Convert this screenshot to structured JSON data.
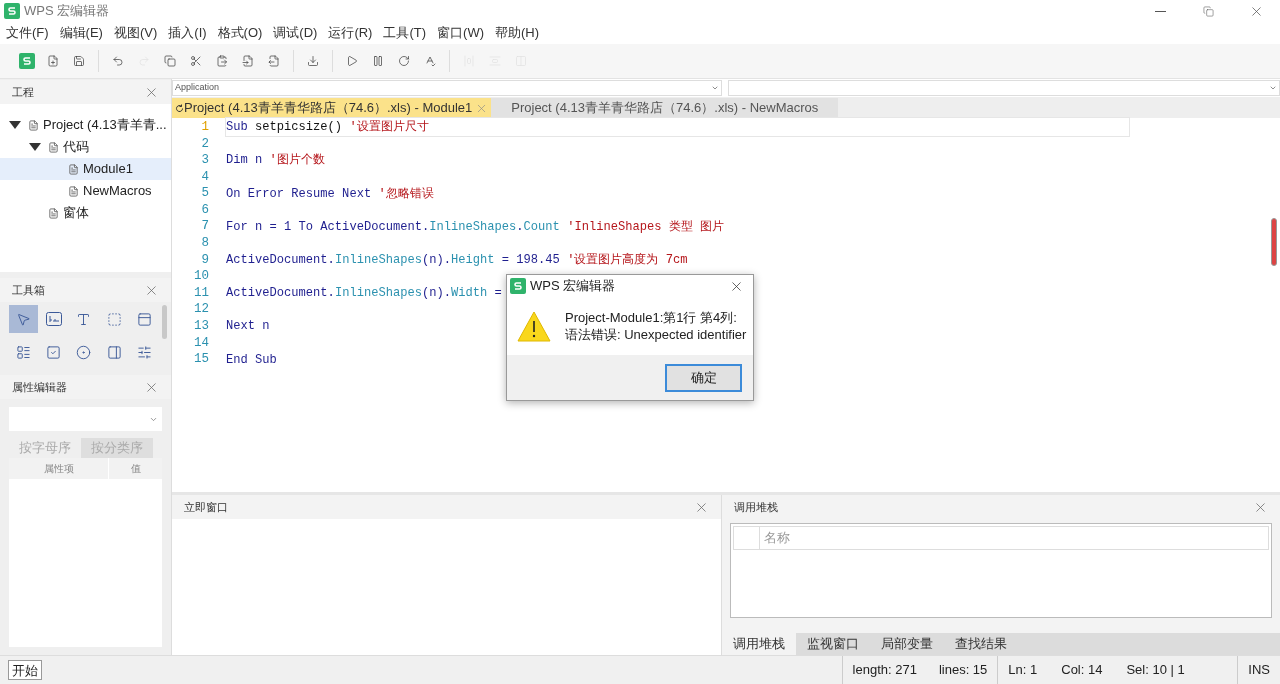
{
  "window": {
    "title": "WPS 宏编辑器"
  },
  "menu": [
    "文件(F)",
    "编辑(E)",
    "视图(V)",
    "插入(I)",
    "格式(O)",
    "调试(D)",
    "运行(R)",
    "工具(T)",
    "窗口(W)",
    "帮助(H)"
  ],
  "toolbar": [
    [
      {
        "disabled": false
      },
      {
        "disabled": false
      },
      {
        "disabled": false
      }
    ],
    [
      {
        "disabled": false
      },
      {
        "disabled": true
      },
      {
        "disabled": false
      },
      {
        "disabled": false
      },
      {
        "disabled": false
      },
      {
        "disabled": false
      },
      {
        "disabled": false
      }
    ],
    [
      {
        "disabled": false
      }
    ],
    [
      {
        "disabled": false
      },
      {
        "disabled": false
      },
      {
        "disabled": false
      },
      {
        "disabled": false
      }
    ],
    [
      {
        "disabled": true
      },
      {
        "disabled": true
      },
      {
        "disabled": true
      }
    ]
  ],
  "project_panel": {
    "title": "工程",
    "tree": [
      {
        "label": "Project (4.13青羊青...",
        "expanded": true,
        "selected": false,
        "children": [
          {
            "label": "代码",
            "expanded": true,
            "selected": false,
            "children": [
              {
                "label": "Module1",
                "selected": true
              },
              {
                "label": "NewMacros",
                "selected": false
              }
            ]
          },
          {
            "label": "窗体",
            "selected": false
          }
        ]
      }
    ]
  },
  "toolbox_panel": {
    "title": "工具箱",
    "tools": [
      {
        "selected": true
      },
      {
        "selected": false
      },
      {
        "selected": false
      },
      {
        "selected": false
      },
      {
        "selected": false
      },
      {
        "selected": false
      },
      {
        "selected": false
      },
      {
        "selected": false
      },
      {
        "selected": false
      },
      {
        "selected": false
      }
    ]
  },
  "property_panel": {
    "title": "属性编辑器",
    "tabs": [
      {
        "label": "按字母序",
        "selected": true
      },
      {
        "label": "按分类序",
        "selected": false
      }
    ],
    "columns": [
      "属性项",
      "值"
    ]
  },
  "editor": {
    "object_combo": "Application",
    "tabs": [
      {
        "label": "Project (4.13青羊青华路店（74.6）.xls) - Module1",
        "selected": true
      },
      {
        "label": "Project (4.13青羊青华路店（74.6）.xls) - NewMacros",
        "selected": false
      }
    ],
    "lines": [
      {
        "number": "1",
        "tokens": [
          {
            "kind": "keyword",
            "text": "Sub"
          },
          {
            "kind": "plain",
            "text": " setpicsize() "
          },
          {
            "kind": "comment",
            "text": "'设置图片尺寸"
          }
        ]
      },
      {
        "number": "2"
      },
      {
        "number": "3",
        "tokens": [
          {
            "kind": "keyword",
            "text": "Dim n "
          },
          {
            "kind": "comment",
            "text": "'图片个数"
          }
        ]
      },
      {
        "number": "4"
      },
      {
        "number": "5",
        "tokens": [
          {
            "kind": "keyword",
            "text": "On Error Resume Next "
          },
          {
            "kind": "comment",
            "text": "'忽略错误"
          }
        ]
      },
      {
        "number": "6"
      },
      {
        "number": "7",
        "tokens": [
          {
            "kind": "keyword",
            "text": "For n = 1 To ActiveDocument."
          },
          {
            "kind": "member",
            "text": "InlineShapes"
          },
          {
            "kind": "keyword",
            "text": "."
          },
          {
            "kind": "member",
            "text": "Count"
          },
          {
            "kind": "comment",
            "text": " 'InlineShapes 类型 图片"
          }
        ]
      },
      {
        "number": "8"
      },
      {
        "number": "9",
        "tokens": [
          {
            "kind": "keyword",
            "text": "ActiveDocument."
          },
          {
            "kind": "member",
            "text": "InlineShapes"
          },
          {
            "kind": "keyword",
            "text": "(n)."
          },
          {
            "kind": "member",
            "text": "Height"
          },
          {
            "kind": "keyword",
            "text": " = 198.45 "
          },
          {
            "kind": "comment",
            "text": "'设置图片高度为 7cm"
          }
        ]
      },
      {
        "number": "10"
      },
      {
        "number": "11",
        "tokens": [
          {
            "kind": "keyword",
            "text": "ActiveDocument."
          },
          {
            "kind": "member",
            "text": "InlineShapes"
          },
          {
            "kind": "keyword",
            "text": "(n)."
          },
          {
            "kind": "member",
            "text": "Width"
          },
          {
            "kind": "keyword",
            "text": " ="
          }
        ]
      },
      {
        "number": "12"
      },
      {
        "number": "13",
        "tokens": [
          {
            "kind": "keyword",
            "text": "Next n"
          }
        ]
      },
      {
        "number": "14"
      },
      {
        "number": "15",
        "tokens": [
          {
            "kind": "keyword",
            "text": "End Sub"
          }
        ]
      }
    ]
  },
  "immediate_panel": {
    "title": "立即窗口"
  },
  "callstack_panel": {
    "title": "调用堆栈",
    "column": "名称",
    "tabs": [
      {
        "label": "调用堆栈",
        "selected": true
      },
      {
        "label": "监视窗口",
        "selected": false
      },
      {
        "label": "局部变量",
        "selected": false
      },
      {
        "label": "查找结果",
        "selected": false
      }
    ]
  },
  "dialog": {
    "title": "WPS 宏编辑器",
    "message": [
      "Project-Module1:第1行 第4列:",
      "语法错误: Unexpected identifier"
    ],
    "button": "确定"
  },
  "status_bar": {
    "start": "开始",
    "length": "length: 271",
    "lines": "lines: 15",
    "ln": "Ln: 1",
    "col": "Col: 14",
    "sel": "Sel: 10 | 1",
    "mode": "INS"
  }
}
